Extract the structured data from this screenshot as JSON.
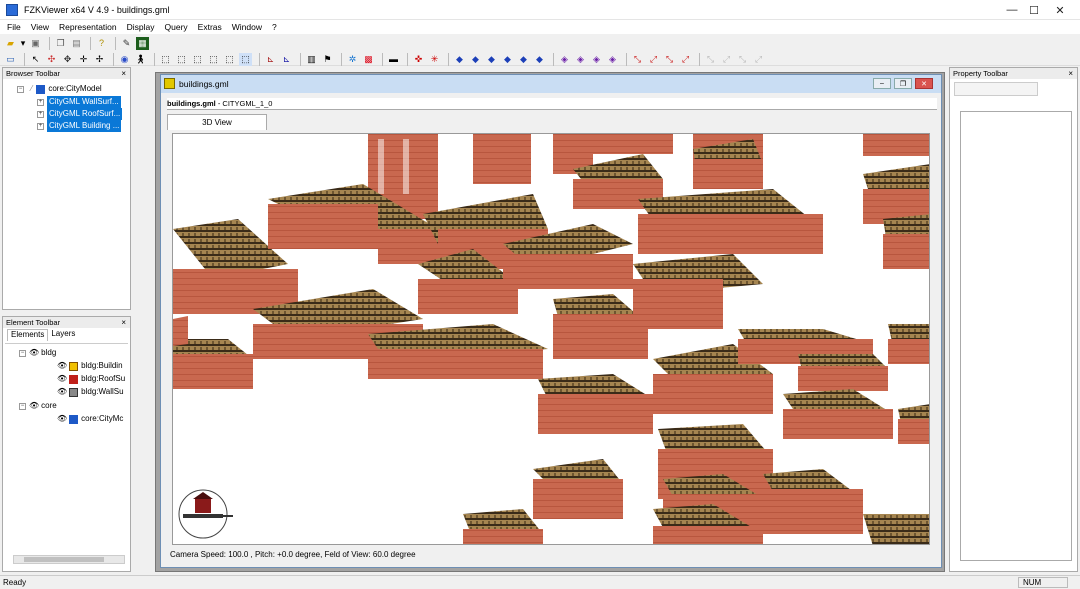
{
  "window": {
    "title": "FZKViewer x64 V 4.9 - buildings.gml",
    "minimize": "—",
    "maximize": "☐",
    "close": "✕"
  },
  "menu": [
    "File",
    "View",
    "Representation",
    "Display",
    "Query",
    "Extras",
    "Window",
    "?"
  ],
  "browser_toolbar": {
    "title": "Browser Toolbar",
    "close": "×",
    "root": "core:CityModel",
    "items": [
      "CityGML WallSurf...",
      "CityGML RoofSurf...",
      "CityGML Building ..."
    ]
  },
  "element_toolbar": {
    "title": "Element Toolbar",
    "close": "×",
    "tabs": [
      "Elements",
      "Layers"
    ],
    "groups": [
      {
        "label": "bldg",
        "items": [
          "bldg:Buildin",
          "bldg:RoofSu",
          "bldg:WallSu"
        ]
      },
      {
        "label": "core",
        "items": [
          "core:CityMc"
        ]
      }
    ]
  },
  "property_toolbar": {
    "title": "Property Toolbar",
    "close": "×"
  },
  "document": {
    "title": "buildings.gml",
    "breadcrumb_file": "buildings.gml",
    "breadcrumb_rest": " - CITYGML_1_0",
    "tab": "3D View",
    "status": "Camera Speed: 100.0 , Pitch: +0.0 degree, Feld of View: 60.0 degree"
  },
  "statusbar": {
    "left": "Ready",
    "right": "NUM"
  },
  "colors": {
    "selection": "#0a78d7",
    "wall": "#c9684f",
    "roof": "#8a6a3a",
    "child_title": "#c9ddf3"
  }
}
